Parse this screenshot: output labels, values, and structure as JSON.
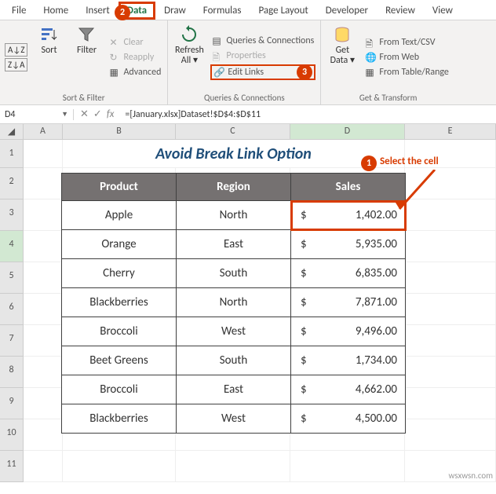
{
  "tabs": [
    "File",
    "Home",
    "Insert",
    "Data",
    "Draw",
    "Formulas",
    "Page Layout",
    "Developer",
    "Review",
    "View"
  ],
  "ribbon": {
    "sort_filter": {
      "sort": "Sort",
      "filter": "Filter",
      "clear": "Clear",
      "reapply": "Reapply",
      "advanced": "Advanced",
      "group": "Sort & Filter"
    },
    "queries": {
      "refresh": "Refresh All",
      "qc": "Queries & Connections",
      "props": "Properties",
      "edit_links": "Edit Links",
      "group": "Queries & Connections"
    },
    "get": {
      "get_data": "Get Data",
      "text_csv": "From Text/CSV",
      "web": "From Web",
      "table": "From Table/Range",
      "group": "Get & Transform"
    }
  },
  "namebox": "D4",
  "formula": "=[January.xlsx]Dataset!$D$4:$D$11",
  "cols": [
    "A",
    "B",
    "C",
    "D",
    "E"
  ],
  "rows": [
    "1",
    "2",
    "3",
    "4",
    "5",
    "6",
    "7",
    "8",
    "9",
    "10",
    "11"
  ],
  "title": "Avoid Break Link Option",
  "headers": {
    "product": "Product",
    "region": "Region",
    "sales": "Sales"
  },
  "currency": "$",
  "data": [
    {
      "product": "Apple",
      "region": "North",
      "sales": "1,402.00"
    },
    {
      "product": "Orange",
      "region": "East",
      "sales": "5,935.00"
    },
    {
      "product": "Cherry",
      "region": "South",
      "sales": "6,835.00"
    },
    {
      "product": "Blackberries",
      "region": "North",
      "sales": "7,871.00"
    },
    {
      "product": "Broccoli",
      "region": "West",
      "sales": "9,496.00"
    },
    {
      "product": "Beet Greens",
      "region": "South",
      "sales": "1,734.00"
    },
    {
      "product": "Broccoli",
      "region": "East",
      "sales": "4,662.00"
    },
    {
      "product": "Blackberries",
      "region": "West",
      "sales": "4,500.00"
    }
  ],
  "annot": {
    "b1": "1",
    "b2": "2",
    "b3": "3",
    "select_cell": "Select the cell"
  },
  "watermark": "wsxwsn.com"
}
